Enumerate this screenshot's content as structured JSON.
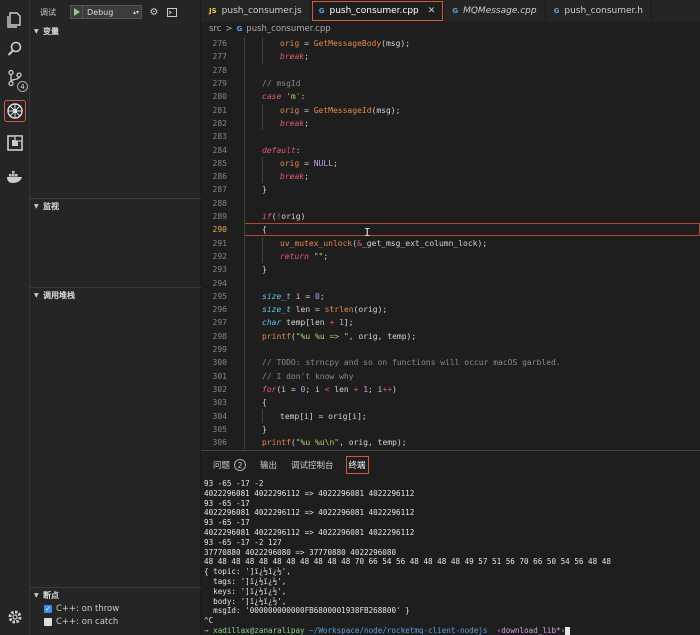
{
  "debug": {
    "title": "调试",
    "config": "Debug",
    "sections": {
      "variables": "变量",
      "watch": "监视",
      "callstack": "调用堆栈",
      "breakpoints": "断点"
    },
    "breakpoints": [
      {
        "label": "C++: on throw",
        "checked": true
      },
      {
        "label": "C++: on catch",
        "checked": false
      }
    ]
  },
  "activity": {
    "scm_badge": "4"
  },
  "tabs": [
    {
      "name": "push_consumer.js",
      "type": "js",
      "active": false
    },
    {
      "name": "push_consumer.cpp",
      "type": "cpp",
      "active": true
    },
    {
      "name": "MQMessage.cpp",
      "type": "cpp",
      "active": false
    },
    {
      "name": "push_consumer.h",
      "type": "cpp",
      "active": false
    }
  ],
  "tab_icons": {
    "js": "JS",
    "cpp": "G"
  },
  "breadcrumb": {
    "folder": "src",
    "sep": ">",
    "file": "push_consumer.cpp"
  },
  "editor": {
    "current_line": 290,
    "lines": [
      {
        "n": 276,
        "html": "<span class=\"var\">orig</span> = <span class=\"fn\">GetMessageBody</span>(msg);",
        "indent": 3
      },
      {
        "n": 277,
        "html": "<span class=\"kw\">break</span>;",
        "indent": 3
      },
      {
        "n": 278,
        "html": "",
        "indent": 0
      },
      {
        "n": 279,
        "html": "<span class=\"cm\">// msgId</span>",
        "indent": 2
      },
      {
        "n": 280,
        "html": "<span class=\"kw\">case</span> <span class=\"str\">'m'</span>:",
        "indent": 2
      },
      {
        "n": 281,
        "html": "<span class=\"var\">orig</span> = <span class=\"fn\">GetMessageId</span>(msg);",
        "indent": 3
      },
      {
        "n": 282,
        "html": "<span class=\"kw\">break</span>;",
        "indent": 3
      },
      {
        "n": 283,
        "html": "",
        "indent": 0
      },
      {
        "n": 284,
        "html": "<span class=\"kw\">default</span>:",
        "indent": 2
      },
      {
        "n": 285,
        "html": "<span class=\"var\">orig</span> = <span class=\"num\">NULL</span>;",
        "indent": 3
      },
      {
        "n": 286,
        "html": "<span class=\"kw\">break</span>;",
        "indent": 3
      },
      {
        "n": 287,
        "html": "}",
        "indent": 2
      },
      {
        "n": 288,
        "html": "",
        "indent": 0
      },
      {
        "n": 289,
        "html": "<span class=\"kw\">if</span>(<span class=\"op\">!</span>orig)",
        "indent": 2
      },
      {
        "n": 290,
        "html": "{",
        "indent": 2
      },
      {
        "n": 291,
        "html": "<span class=\"fn\">uv_mutex_unlock</span>(<span class=\"op\">&amp;</span>_get_msg_ext_column_lock);",
        "indent": 3
      },
      {
        "n": 292,
        "html": "<span class=\"kw\">return</span> <span class=\"str\">\"\"</span>;",
        "indent": 3
      },
      {
        "n": 293,
        "html": "}",
        "indent": 2
      },
      {
        "n": 294,
        "html": "",
        "indent": 0
      },
      {
        "n": 295,
        "html": "<span class=\"ty\">size_t</span> i = <span class=\"num\">0</span>;",
        "indent": 2
      },
      {
        "n": 296,
        "html": "<span class=\"ty\">size_t</span> len = <span class=\"fn\">strlen</span>(orig);",
        "indent": 2
      },
      {
        "n": 297,
        "html": "<span class=\"ty\">char</span> temp[len <span class=\"op\">+</span> <span class=\"num\">1</span>];",
        "indent": 2
      },
      {
        "n": 298,
        "html": "<span class=\"fn\">printf</span>(<span class=\"str\">\"%u %u =&gt; \"</span>, orig, temp);",
        "indent": 2
      },
      {
        "n": 299,
        "html": "",
        "indent": 0
      },
      {
        "n": 300,
        "html": "<span class=\"cm\">// TODO: strncpy and so on functions will occur macOS garbled.</span>",
        "indent": 2
      },
      {
        "n": 301,
        "html": "<span class=\"cm\">// I don't know why</span>",
        "indent": 2
      },
      {
        "n": 302,
        "html": "<span class=\"kw\">for</span>(i = <span class=\"num\">0</span>; i <span class=\"op\">&lt;</span> len <span class=\"op\">+</span> <span class=\"num\">1</span>; i<span class=\"op\">++</span>)",
        "indent": 2
      },
      {
        "n": 303,
        "html": "{",
        "indent": 2
      },
      {
        "n": 304,
        "html": "temp[i] = orig[i];",
        "indent": 3
      },
      {
        "n": 305,
        "html": "}",
        "indent": 2
      },
      {
        "n": 306,
        "html": "<span class=\"fn\">printf</span>(<span class=\"str\">\"%u %u\\n\"</span>, orig, temp);",
        "indent": 2
      }
    ]
  },
  "panel": {
    "tabs": [
      {
        "label": "问题",
        "badge": "2",
        "active": false
      },
      {
        "label": "输出",
        "active": false
      },
      {
        "label": "调试控制台",
        "active": false
      },
      {
        "label": "终端",
        "active": true
      }
    ]
  },
  "terminal": {
    "lines": [
      "93 -65 -17 -2",
      "4022296081 4022296112 => 4022296081 4022296112",
      "93 -65 -17",
      "4022296081 4022296112 => 4022296081 4022296112",
      "93 -65 -17",
      "4022296081 4022296112 => 4022296081 4022296112",
      "93 -65 -17 -2 127",
      "37770880 4022296080 => 37770880 4022296080",
      "48 48 48 48 48 48 48 48 48 48 48 70 66 54 56 48 48 48 48 49 57 51 56 70 66 50 54 56 48 48",
      "{ topic: ']ï¿½ï¿½',",
      "  tags: ']ï¿½ï¿½',",
      "  keys: ']ï¿½ï¿½',",
      "  body: ']ï¿½ï¿½',",
      "  msgId: '000000000000FB6800001938FB268800' }",
      "^C"
    ],
    "prompt": {
      "marker": "→",
      "user": "xadillax@zanaralipay",
      "path": "~/Workspace/node/rocketmq-client-nodejs",
      "branch": "‹download_lib*›"
    }
  }
}
